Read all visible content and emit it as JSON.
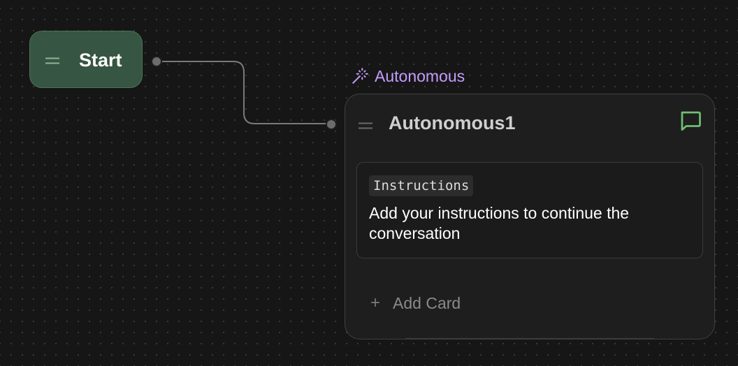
{
  "canvas": {
    "dot_color": "#3a3a3a",
    "background": "#161616"
  },
  "start_node": {
    "title": "Start",
    "color": "#365542",
    "handle_icon": "drag-handle-icon"
  },
  "autonomous_node": {
    "type_label": "Autonomous",
    "type_icon": "magic-wand-icon",
    "type_color": "#c49cff",
    "title": "Autonomous1",
    "chat_icon": "chat-bubble-icon",
    "chat_icon_color": "#6fbf73",
    "card": {
      "tag": "Instructions",
      "text": "Add your instructions to continue the conversation"
    },
    "add_card_label": "Add Card",
    "add_card_icon": "+"
  }
}
